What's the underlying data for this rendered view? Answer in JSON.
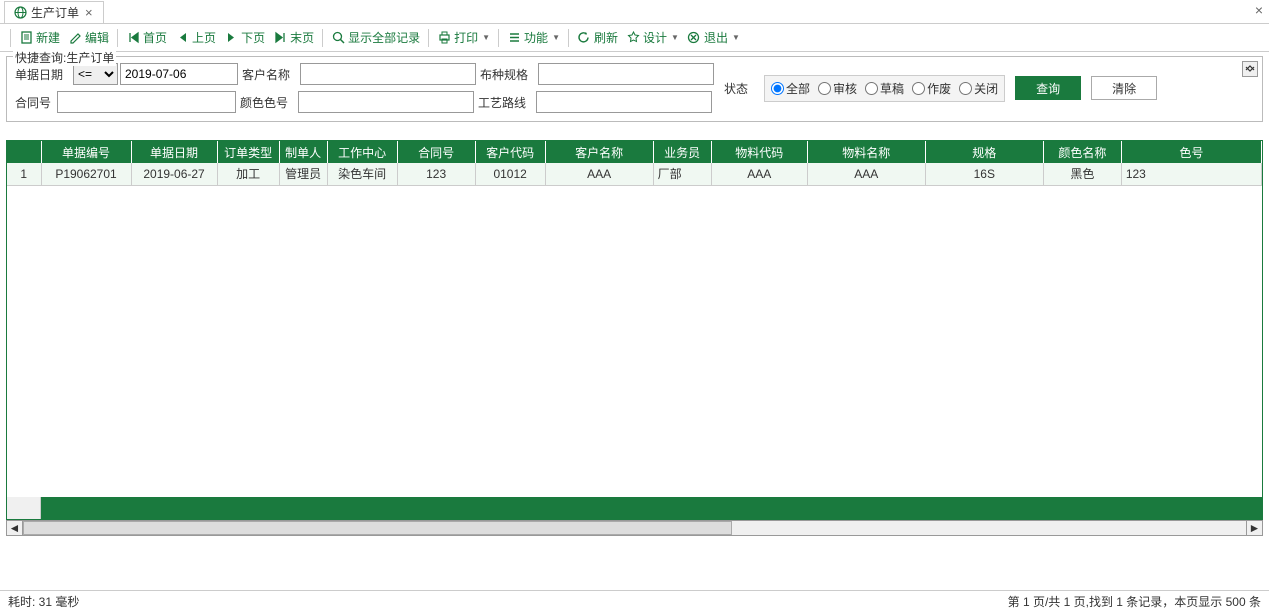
{
  "tab": {
    "title": "生产订单"
  },
  "toolbar": {
    "new": "新建",
    "edit": "编辑",
    "first": "首页",
    "prev": "上页",
    "next": "下页",
    "last": "末页",
    "showall": "显示全部记录",
    "print": "打印",
    "func": "功能",
    "refresh": "刷新",
    "design": "设计",
    "exit": "退出"
  },
  "search": {
    "legend": "快捷查询:生产订单",
    "labels": {
      "date": "单据日期",
      "customer": "客户名称",
      "spec": "布种规格",
      "contract": "合同号",
      "color": "颜色色号",
      "route": "工艺路线",
      "status": "状态"
    },
    "op_value": "<=",
    "op_options": [
      "<=",
      ">=",
      "="
    ],
    "date_value": "2019-07-06",
    "customer_value": "",
    "spec_value": "",
    "contract_value": "",
    "color_value": "",
    "route_value": "",
    "status_options": [
      "全部",
      "审核",
      "草稿",
      "作废",
      "关闭"
    ],
    "status_selected": "全部",
    "query_btn": "查询",
    "clear_btn": "清除"
  },
  "table": {
    "headers": [
      "",
      "单据编号",
      "单据日期",
      "订单类型",
      "制单人",
      "工作中心",
      "合同号",
      "客户代码",
      "客户名称",
      "业务员",
      "物料代码",
      "物料名称",
      "规格",
      "颜色名称",
      "色号"
    ],
    "rows": [
      {
        "n": "1",
        "cells": [
          "P19062701",
          "2019-06-27",
          "加工",
          "管理员",
          "染色车间",
          "123",
          "01012",
          "AAA",
          "厂部",
          "AAA",
          "AAA",
          "16S",
          "黑色",
          "123"
        ]
      }
    ]
  },
  "status": {
    "elapsed": "耗时: 31 毫秒",
    "pager": "第 1 页/共 1 页,找到 1 条记录，本页显示 500 条"
  }
}
